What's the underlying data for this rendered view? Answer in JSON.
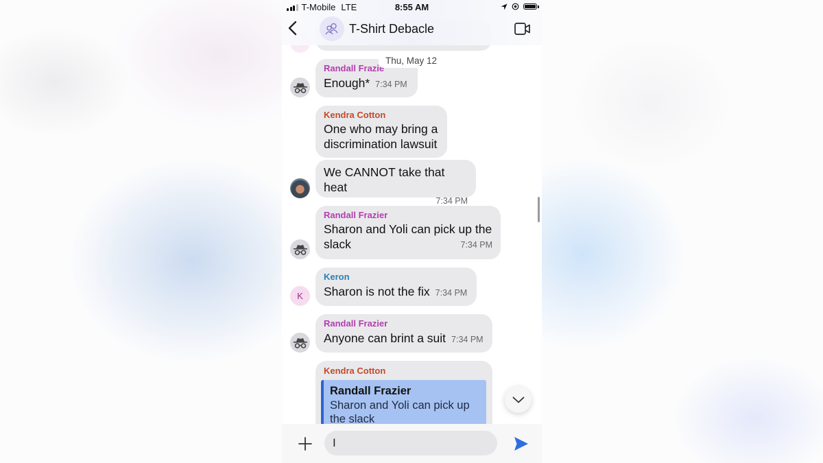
{
  "status_bar": {
    "carrier": "T-Mobile",
    "network": "LTE",
    "time": "8:55 AM",
    "signal_bars_active": 3,
    "signal_bars_total": 4,
    "icons": [
      "location-arrow-icon",
      "orientation-lock-icon",
      "battery-icon"
    ]
  },
  "header": {
    "back_icon": "chevron-left-icon",
    "group_icon": "group-people-icon",
    "title": "T-Shirt Debacle",
    "video_icon": "video-camera-icon"
  },
  "date_separator": "Thu, May 12",
  "messages": [
    {
      "sender": "Randall Frazier",
      "sender_visible": "Randall Frazie",
      "avatar": "incognito-icon",
      "lines": [
        "Enough*"
      ],
      "time": "7:34 PM"
    },
    {
      "sender": "Kendra Cotton",
      "avatar": "",
      "lines": [
        "One who may bring a",
        "discrimination lawsuit"
      ],
      "time": ""
    },
    {
      "sender": "",
      "avatar": "photo",
      "lines": [
        "We CANNOT take that heat"
      ],
      "time": "7:34 PM"
    },
    {
      "sender": "Randall Frazier",
      "avatar": "incognito-icon",
      "lines": [
        "Sharon and Yoli can pick up the",
        "slack"
      ],
      "time": "7:34 PM"
    },
    {
      "sender": "Keron",
      "avatar": "K",
      "lines": [
        "Sharon is not the fix"
      ],
      "time": "7:34 PM"
    },
    {
      "sender": "Randall Frazier",
      "avatar": "incognito-icon",
      "lines": [
        "Anyone can brint a suit"
      ],
      "time": "7:34 PM"
    },
    {
      "sender": "Kendra Cotton",
      "avatar": "",
      "reply_to": {
        "sender": "Randall Frazier",
        "lines": [
          "Sharon and Yoli can pick up",
          "the slack"
        ]
      },
      "lines": [],
      "time": ""
    }
  ],
  "composer": {
    "add_icon": "plus-icon",
    "input_value": "I",
    "send_icon": "send-icon"
  },
  "scroll_down_icon": "chevron-down-icon",
  "colors": {
    "randall": "#b43cb0",
    "kendra": "#c24a2a",
    "keron": "#2a7fb3",
    "bubble": "#e9e9eb",
    "quote_bg": "#a6c2f2",
    "quote_bar": "#2d63d4",
    "send": "#2d6fe0"
  }
}
